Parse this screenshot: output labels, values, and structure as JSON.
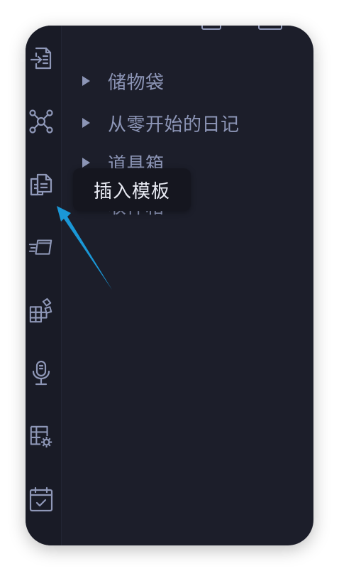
{
  "ribbon": {
    "icons": [
      "open-file-icon",
      "graph-view-icon",
      "insert-template-icon",
      "slides-icon",
      "plugins-icon",
      "microphone-icon",
      "table-settings-icon",
      "calendar-check-icon"
    ]
  },
  "tree": {
    "items": [
      {
        "label": "储物袋"
      },
      {
        "label": "从零开始的日记"
      },
      {
        "label": "道具箱"
      },
      {
        "label": "收件箱"
      }
    ]
  },
  "tooltip": {
    "text": "插入模板"
  },
  "colors": {
    "background": "#1c1e2a",
    "ribbon": "#191b26",
    "icon": "#8f98b8",
    "tree_text": "#8c95b6",
    "tooltip_bg": "#15161f",
    "tooltip_text": "#e7e9f2",
    "annotation_arrow": "#1a97d6"
  }
}
